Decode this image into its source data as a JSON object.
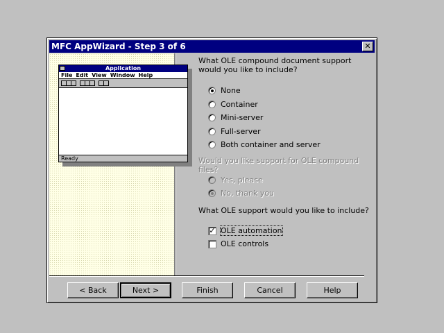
{
  "dialog": {
    "title": "MFC AppWizard - Step 3 of 6",
    "close_glyph": "✕"
  },
  "preview": {
    "title": "Application",
    "menu": [
      "File",
      "Edit",
      "View",
      "Window",
      "Help"
    ],
    "status": "Ready"
  },
  "compound": {
    "question": "What OLE compound document support would you like to include?",
    "options": [
      {
        "label": "None",
        "selected": true
      },
      {
        "label": "Container",
        "selected": false
      },
      {
        "label": "Mini-server",
        "selected": false
      },
      {
        "label": "Full-server",
        "selected": false
      },
      {
        "label": "Both container and server",
        "selected": false
      }
    ]
  },
  "files": {
    "question": "Would you like support for OLE compound files?",
    "options": [
      {
        "label": "Yes, please",
        "selected": false
      },
      {
        "label": "No, thank you",
        "selected": true
      }
    ]
  },
  "support": {
    "question": "What OLE support would you like to include?",
    "options": [
      {
        "label": "OLE automation",
        "checked": true
      },
      {
        "label": "OLE controls",
        "checked": false
      }
    ]
  },
  "buttons": {
    "back": "< Back",
    "next": "Next >",
    "finish": "Finish",
    "cancel": "Cancel",
    "help": "Help"
  },
  "colors": {
    "titlebar": "#000080",
    "face": "#c0c0c0",
    "panel": "#ffffe6"
  }
}
